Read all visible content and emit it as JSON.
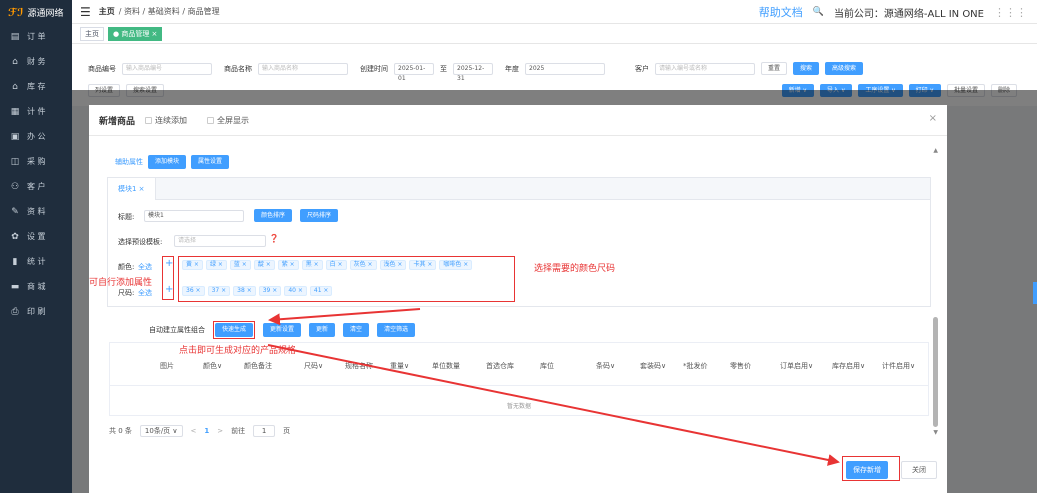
{
  "app": {
    "logo_mark": "ℱℐ",
    "logo_text": "源通网络"
  },
  "sidebar": {
    "items": [
      {
        "icon": "▤",
        "label": "订 单"
      },
      {
        "icon": "⌂",
        "label": "财 务"
      },
      {
        "icon": "⌂",
        "label": "库 存"
      },
      {
        "icon": "▦",
        "label": "计 件"
      },
      {
        "icon": "▣",
        "label": "办 公"
      },
      {
        "icon": "◫",
        "label": "采 购"
      },
      {
        "icon": "⚇",
        "label": "客 户"
      },
      {
        "icon": "✎",
        "label": "资 料"
      },
      {
        "icon": "✿",
        "label": "设 置"
      },
      {
        "icon": "▮",
        "label": "统 计"
      },
      {
        "icon": "▬",
        "label": "商 城"
      },
      {
        "icon": "⎙",
        "label": "印 刷"
      }
    ]
  },
  "topbar": {
    "menu_icon": "☰",
    "crumb_home": "主页",
    "crumb_path": "/ 资料 / 基础资料 / 商品管理",
    "help": "帮助文档",
    "search_icon": "🔍",
    "company": "当前公司：源通网络-ALL IN ONE"
  },
  "tags": {
    "home": "主页",
    "current": "● 商品管理 ×"
  },
  "filter": {
    "code_label": "商品编号",
    "code_ph": "输入商品编号",
    "name_label": "商品名称",
    "name_ph": "输入商品名称",
    "created_label": "创建时间",
    "date_from": "2025-01-01",
    "date_sep": "至",
    "date_to": "2025-12-31",
    "year_label": "年度",
    "year_value": "2025",
    "customer_label": "客户",
    "customer_ph": "请输入编号或名称",
    "reset": "重置",
    "search": "搜索",
    "adv_search": "高级搜索",
    "col_setting": "列设置",
    "search_setting": "搜索设置",
    "add": "新增 ∨",
    "import": "导入 ∨",
    "process": "工序设置 ∨",
    "print": "打印 ∨",
    "batch": "批量设置",
    "delete": "删除"
  },
  "dialog": {
    "title": "新增商品",
    "continuous": "连续添加",
    "fullscreen": "全屏显示",
    "close": "×",
    "aux_label": "辅助属性",
    "add_module": "添加模块",
    "attr_setting": "属性设置",
    "tab": "模块1 ×",
    "title_label": "标题:",
    "title_value": "模块1",
    "color_sort": "颜色排序",
    "size_sort": "尺码排序",
    "preset_label": "选择预设模板:",
    "preset_ph": "请选择",
    "color_label": "颜色:",
    "color_all": "全选",
    "size_label": "尺码:",
    "size_all": "全选",
    "colors": [
      "黄 ×",
      "绿 ×",
      "蓝 ×",
      "靛 ×",
      "紫 ×",
      "黑 ×",
      "白 ×",
      "灰色 ×",
      "浅色 ×",
      "卡其 ×",
      "咖啡色 ×"
    ],
    "sizes": [
      "36 ×",
      "37 ×",
      "38 ×",
      "39 ×",
      "40 ×",
      "41 ×"
    ],
    "auto_label": "自动建立属性组合",
    "quick_gen": "快速生成",
    "update_setting": "更新设置",
    "update": "更新",
    "clear": "清空",
    "clear_filter": "清空筛选",
    "columns": [
      "图片",
      "颜色∨",
      "颜色备注",
      "尺码∨",
      "规格名称",
      "重量∨",
      "单位数量",
      "首选仓库",
      "库位",
      "条码∨",
      "套装码∨",
      "*批发价",
      "零售价",
      "订单启用∨",
      "库存启用∨",
      "计件启用∨"
    ],
    "empty": "暂无数据",
    "pager": {
      "total": "共 0 条",
      "size": "10条/页 ∨",
      "prev": "<",
      "page": "1",
      "next": ">",
      "goto": "前往",
      "goto_val": "1",
      "unit": "页"
    },
    "save": "保存新增",
    "close_btn": "关闭"
  },
  "annotations": {
    "color_size": "选择需要的颜色尺码",
    "add_attr": "可自行添加属性",
    "click_gen": "点击即可生成对应的产品规格"
  },
  "colors": {
    "primary": "#409eff",
    "annotation": "#e83434",
    "sidebar": "#1f2d3d"
  }
}
